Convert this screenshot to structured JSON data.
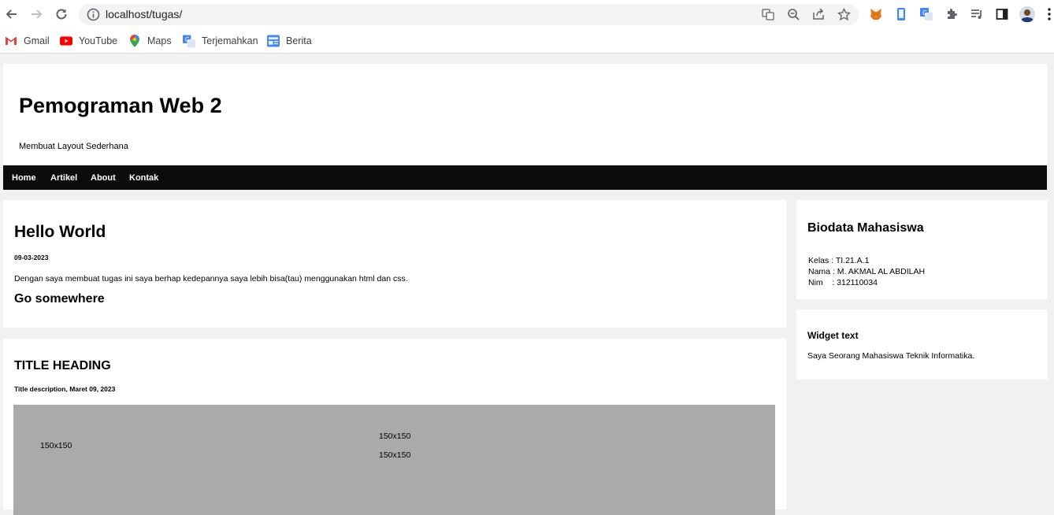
{
  "browser": {
    "url": "localhost/tugas/",
    "bookmarks": [
      {
        "label": "Gmail",
        "icon": "gmail-icon"
      },
      {
        "label": "YouTube",
        "icon": "youtube-icon"
      },
      {
        "label": "Maps",
        "icon": "maps-icon"
      },
      {
        "label": "Terjemahkan",
        "icon": "translate-icon"
      },
      {
        "label": "Berita",
        "icon": "news-icon"
      }
    ]
  },
  "site": {
    "title": "Pemograman Web 2",
    "subtitle": "Membuat Layout Sederhana",
    "nav": [
      "Home",
      "Artikel",
      "About",
      "Kontak"
    ]
  },
  "article1": {
    "heading": "Hello World",
    "date": "09-03-2023",
    "text": "Dengan saya membuat tugas ini saya berhap kedepannya saya lebih bisa(tau) menggunakan html dan css.",
    "link": "Go somewhere"
  },
  "article2": {
    "heading": "TITLE HEADING",
    "description": "Title description, Maret 09, 2023",
    "placeholders": [
      "150x150",
      "150x150",
      "150x150"
    ]
  },
  "sidebar": {
    "bio_heading": "Biodata Mahasiswa",
    "bio_lines": [
      "Kelas : TI.21.A.1",
      "Nama : M. AKMAL AL ABDILAH",
      "Nim    : 312110034"
    ],
    "widget_heading": "Widget text",
    "widget_text": "Saya Seorang Mahasiswa Teknik Informatika."
  },
  "colors": {
    "nav_bg": "#0d0b0b",
    "page_bg": "#f1f1f1",
    "placeholder_bg": "#aaaaaa"
  }
}
